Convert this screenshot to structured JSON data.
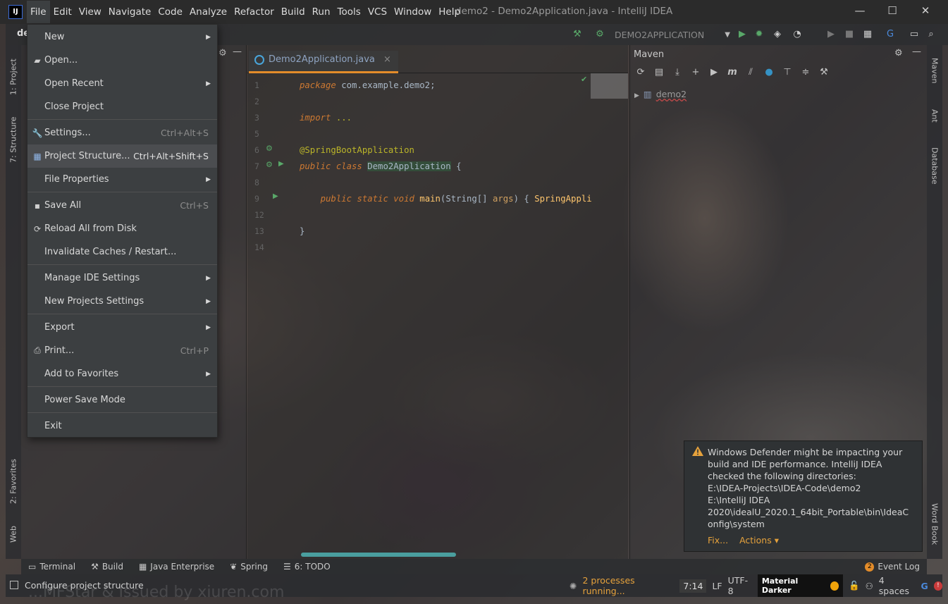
{
  "app": {
    "window_title": "demo2 - Demo2Application.java - IntelliJ IDEA",
    "logo_text": "IJ"
  },
  "menubar": [
    "File",
    "Edit",
    "View",
    "Navigate",
    "Code",
    "Analyze",
    "Refactor",
    "Build",
    "Run",
    "Tools",
    "VCS",
    "Window",
    "Help"
  ],
  "window_controls": {
    "minimize": "—",
    "maximize": "☐",
    "close": "✕"
  },
  "navbar": {
    "project_crumb": "de",
    "run_config": "DEMO2APPLICATION",
    "run_config_arrow": "▼"
  },
  "file_menu": {
    "items": [
      {
        "label": "New",
        "icon": "",
        "shortcut": "",
        "submenu": true
      },
      {
        "label": "Open...",
        "icon": "folder-icon",
        "shortcut": "",
        "submenu": false
      },
      {
        "label": "Open Recent",
        "icon": "",
        "shortcut": "",
        "submenu": true
      },
      {
        "label": "Close Project",
        "icon": "",
        "shortcut": "",
        "submenu": false
      },
      {
        "label": "Settings...",
        "icon": "wrench-icon",
        "shortcut": "Ctrl+Alt+S",
        "submenu": false
      },
      {
        "label": "Project Structure...",
        "icon": "project-structure-icon",
        "shortcut": "Ctrl+Alt+Shift+S",
        "submenu": false,
        "selected": true
      },
      {
        "label": "File Properties",
        "icon": "",
        "shortcut": "",
        "submenu": true
      },
      {
        "label": "Save All",
        "icon": "save-icon",
        "shortcut": "Ctrl+S",
        "submenu": false
      },
      {
        "label": "Reload All from Disk",
        "icon": "reload-icon",
        "shortcut": "",
        "submenu": false
      },
      {
        "label": "Invalidate Caches / Restart...",
        "icon": "",
        "shortcut": "",
        "submenu": false
      },
      {
        "label": "Manage IDE Settings",
        "icon": "",
        "shortcut": "",
        "submenu": true
      },
      {
        "label": "New Projects Settings",
        "icon": "",
        "shortcut": "",
        "submenu": true
      },
      {
        "label": "Export",
        "icon": "",
        "shortcut": "",
        "submenu": true
      },
      {
        "label": "Print...",
        "icon": "print-icon",
        "shortcut": "Ctrl+P",
        "submenu": false
      },
      {
        "label": "Add to Favorites",
        "icon": "",
        "shortcut": "",
        "submenu": true
      },
      {
        "label": "Power Save Mode",
        "icon": "",
        "shortcut": "",
        "submenu": false
      },
      {
        "label": "Exit",
        "icon": "",
        "shortcut": "",
        "submenu": false
      }
    ]
  },
  "editor": {
    "tab_label": "Demo2Application.java",
    "tab_close": "×",
    "line_numbers": [
      "1",
      "2",
      "3",
      "5",
      "6",
      "7",
      "8",
      "9",
      "12",
      "13",
      "14"
    ],
    "code": {
      "line1_kw": "package",
      "line1_rest": " com.example.demo2;",
      "line3_kw": "import",
      "line3_rest": " ...",
      "line6_ann": "@SpringBootApplication",
      "line7_kw": "public class",
      "line7_cls": "Demo2Application",
      "line7_rest": " {",
      "line9_indent": "    ",
      "line9_kw": "public static void",
      "line9_fn": "main",
      "line9_open": "(",
      "line9_type": "String[]",
      "line9_param": "args",
      "line9_close": ") { ",
      "line9_call": "SpringApplicat",
      "line13": "}"
    }
  },
  "maven": {
    "title": "Maven",
    "project": "demo2"
  },
  "left_tools": {
    "project": "1: Project",
    "structure": "7: Structure",
    "favorites": "2: Favorites",
    "web": "Web"
  },
  "right_tools": {
    "maven": "Maven",
    "ant": "Ant",
    "database": "Database",
    "wordbook": "Word Book"
  },
  "tool_windows": [
    "Terminal",
    "Build",
    "Java Enterprise",
    "Spring",
    "6: TODO"
  ],
  "event_log": {
    "count": "2",
    "label": "Event Log"
  },
  "notification": {
    "lines": [
      "Windows Defender might be impacting your",
      "build and IDE performance. IntelliJ IDEA",
      "checked the following directories:",
      "E:\\IDEA-Projects\\IDEA-Code\\demo2",
      "E:\\IntelliJ IDEA",
      "2020\\idealU_2020.1_64bit_Portable\\bin\\IdeaC",
      "onfig\\system"
    ],
    "fix_link": "Fix...",
    "actions_link": "Actions ▾"
  },
  "status": {
    "message": "Configure project structure",
    "processes": "2 processes running...",
    "caret": "7:14",
    "line_sep": "LF",
    "encoding": "UTF-8",
    "theme": "Material Darker",
    "indent": "4 spaces"
  },
  "watermark": "...MFStar & Issued by xiuren.com",
  "colors": {
    "accent_orange": "#e38c2a",
    "run_green": "#59a869",
    "tab_underline": "#e38c2a"
  }
}
